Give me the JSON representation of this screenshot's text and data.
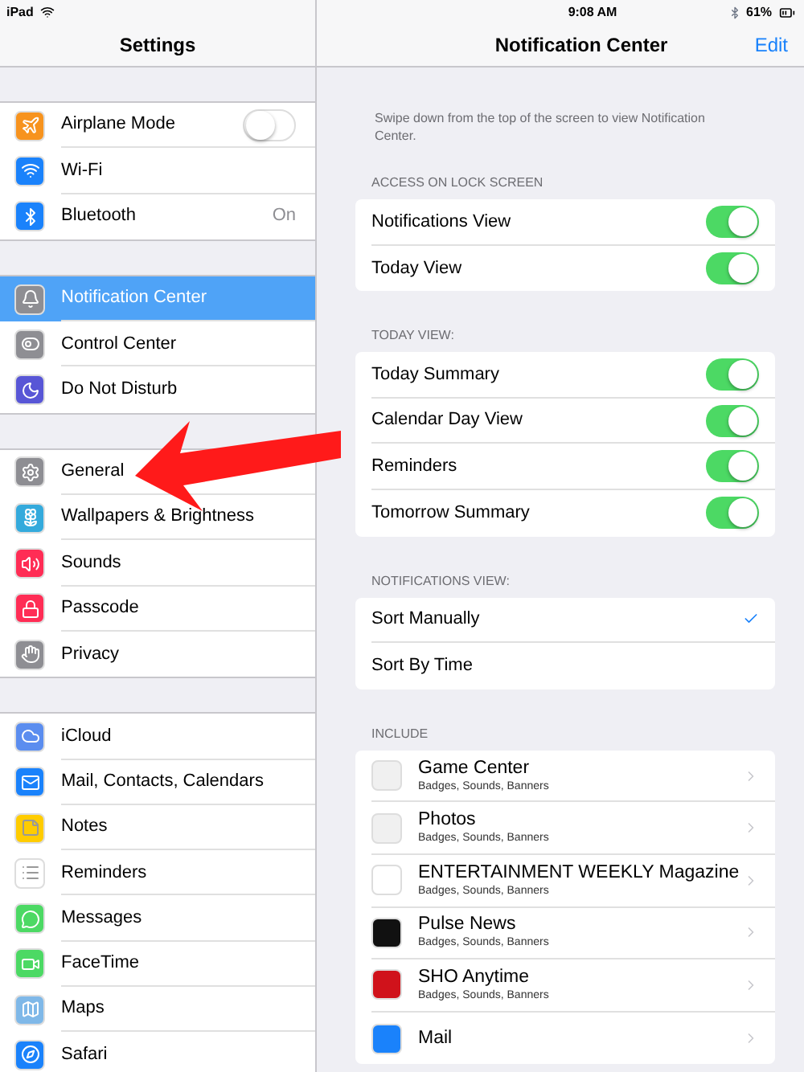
{
  "status_bar": {
    "device": "iPad",
    "time": "9:08 AM",
    "battery": "61%"
  },
  "left_nav": {
    "title": "Settings"
  },
  "right_nav": {
    "title": "Notification Center",
    "action": "Edit"
  },
  "sidebar": {
    "groups": [
      [
        {
          "label": "Airplane Mode",
          "color": "#f7931e",
          "kind": "toggle",
          "on": false,
          "selected": false
        },
        {
          "label": "Wi-Fi",
          "color": "#1a82fb",
          "kind": "plain",
          "selected": false
        },
        {
          "label": "Bluetooth",
          "color": "#1a82fb",
          "kind": "value",
          "value": "On",
          "selected": false
        }
      ],
      [
        {
          "label": "Notification Center",
          "color": "#8e8e93",
          "kind": "plain",
          "selected": true
        },
        {
          "label": "Control Center",
          "color": "#8e8e93",
          "kind": "plain",
          "selected": false
        },
        {
          "label": "Do Not Disturb",
          "color": "#5856d6",
          "kind": "plain",
          "selected": false
        }
      ],
      [
        {
          "label": "General",
          "color": "#8e8e93",
          "kind": "plain",
          "selected": false
        },
        {
          "label": "Wallpapers & Brightness",
          "color": "#34aadc",
          "kind": "plain",
          "selected": false
        },
        {
          "label": "Sounds",
          "color": "#ff2d55",
          "kind": "plain",
          "selected": false
        },
        {
          "label": "Passcode",
          "color": "#ff2d55",
          "kind": "plain",
          "selected": false
        },
        {
          "label": "Privacy",
          "color": "#8e8e93",
          "kind": "plain",
          "selected": false
        }
      ],
      [
        {
          "label": "iCloud",
          "color": "#5b8def",
          "kind": "plain",
          "selected": false
        },
        {
          "label": "Mail, Contacts, Calendars",
          "color": "#1a82fb",
          "kind": "plain",
          "selected": false
        },
        {
          "label": "Notes",
          "color": "#ffcc00",
          "kind": "plain",
          "selected": false
        },
        {
          "label": "Reminders",
          "color": "#ffffff",
          "kind": "plain",
          "selected": false
        },
        {
          "label": "Messages",
          "color": "#4cd964",
          "kind": "plain",
          "selected": false
        },
        {
          "label": "FaceTime",
          "color": "#4cd964",
          "kind": "plain",
          "selected": false
        },
        {
          "label": "Maps",
          "color": "#7fb8e8",
          "kind": "plain",
          "selected": false
        },
        {
          "label": "Safari",
          "color": "#1a82fb",
          "kind": "plain",
          "selected": false
        }
      ]
    ]
  },
  "description": "Swipe down from the top of the screen to view Notification Center.",
  "sections": [
    {
      "header": "ACCESS ON LOCK SCREEN",
      "kind": "toggles",
      "rows": [
        {
          "label": "Notifications View",
          "on": true
        },
        {
          "label": "Today View",
          "on": true
        }
      ]
    },
    {
      "header": "TODAY VIEW:",
      "kind": "toggles",
      "rows": [
        {
          "label": "Today Summary",
          "on": true
        },
        {
          "label": "Calendar Day View",
          "on": true
        },
        {
          "label": "Reminders",
          "on": true
        },
        {
          "label": "Tomorrow Summary",
          "on": true
        }
      ]
    },
    {
      "header": "NOTIFICATIONS VIEW:",
      "kind": "choices",
      "rows": [
        {
          "label": "Sort Manually",
          "selected": true
        },
        {
          "label": "Sort By Time",
          "selected": false
        }
      ]
    },
    {
      "header": "INCLUDE",
      "kind": "apps",
      "rows": [
        {
          "label": "Game Center",
          "detail": "Badges, Sounds, Banners",
          "color": "#f0f0f0"
        },
        {
          "label": "Photos",
          "detail": "Badges, Sounds, Banners",
          "color": "#f0f0f0"
        },
        {
          "label": "ENTERTAINMENT WEEKLY Magazine",
          "detail": "Badges, Sounds, Banners",
          "color": "#ffffff"
        },
        {
          "label": "Pulse News",
          "detail": "Badges, Sounds, Banners",
          "color": "#111111"
        },
        {
          "label": "SHO Anytime",
          "detail": "Badges, Sounds, Banners",
          "color": "#d0121b"
        },
        {
          "label": "Mail",
          "color": "#1a82fb"
        }
      ]
    }
  ]
}
